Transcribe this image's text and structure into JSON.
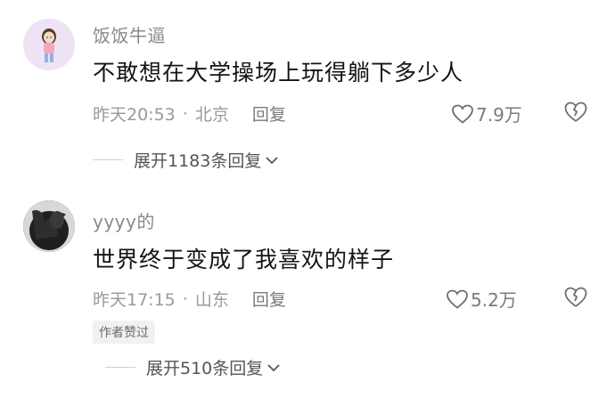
{
  "comments": [
    {
      "username": "饭饭牛逼",
      "text": "不敢想在大学操场上玩得躺下多少人",
      "time": "昨天20:53",
      "separator": "·",
      "location": "北京",
      "reply_label": "回复",
      "likes": "7.9万",
      "expand_label": "展开1183条回复"
    },
    {
      "username": "yyyy的",
      "text": "世界终于变成了我喜欢的样子",
      "time": "昨天17:15",
      "separator": "·",
      "location": "山东",
      "reply_label": "回复",
      "likes": "5.2万",
      "author_badge": "作者赞过",
      "expand_label": "展开510条回复"
    }
  ],
  "icons": {
    "like": "heart-outline-icon",
    "dislike": "broken-heart-icon",
    "expand": "chevron-down-icon"
  },
  "colors": {
    "username": "#8a8a8a",
    "text": "#141414",
    "meta": "#9a9a9a",
    "badge_bg": "#f1f1f1"
  }
}
